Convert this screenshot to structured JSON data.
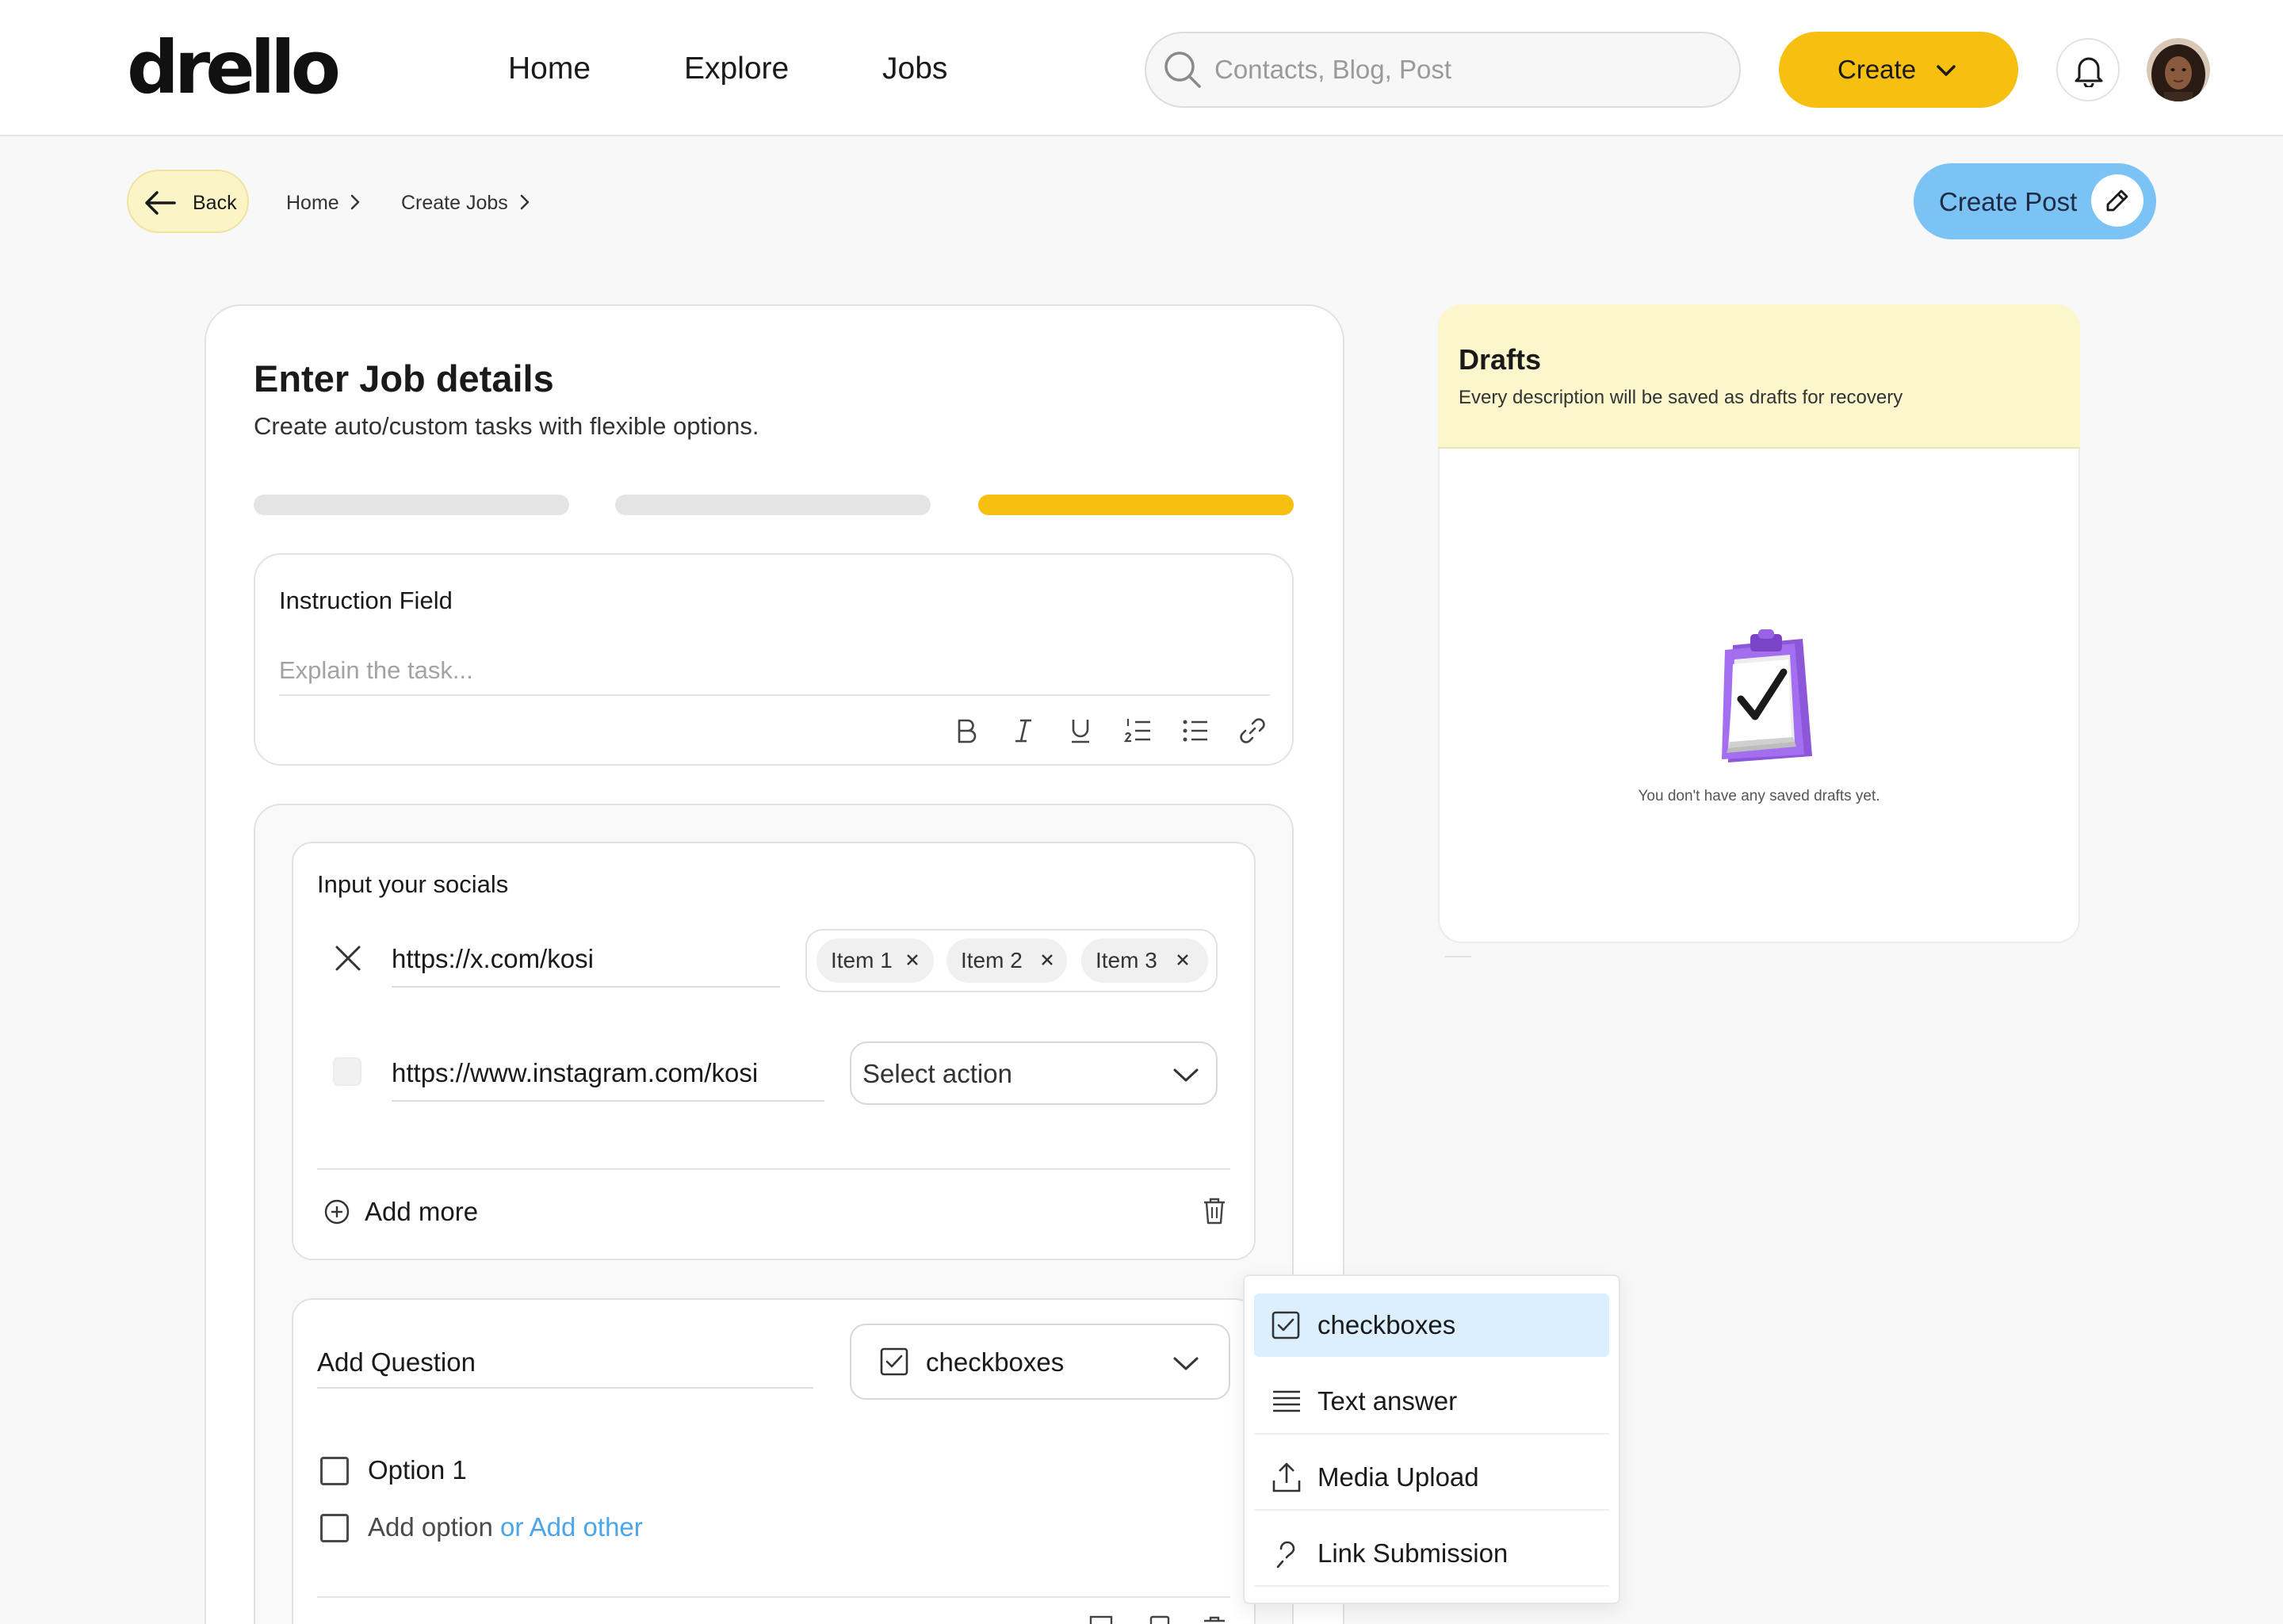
{
  "header": {
    "logo": "drello",
    "nav": [
      "Home",
      "Explore",
      "Jobs"
    ],
    "search": {
      "placeholder": "Contacts, Blog, Post",
      "icon": "search-icon"
    },
    "create_label": "Create",
    "notification_icon": "bell-icon",
    "avatar": "user-avatar"
  },
  "breadcrumb": {
    "back_label": "Back",
    "items": [
      "Home",
      "Create Jobs"
    ],
    "create_post_label": "Create Post"
  },
  "form": {
    "title": "Enter Job details",
    "subtitle": "Create auto/custom tasks with flexible options.",
    "steps": [
      {
        "state": "inactive"
      },
      {
        "state": "inactive"
      },
      {
        "state": "active"
      }
    ],
    "instruction": {
      "label": "Instruction Field",
      "placeholder": "Explain the task...",
      "toolbar": [
        "bold-icon",
        "italic-icon",
        "underline-icon",
        "ordered-list-icon",
        "bullet-list-icon",
        "link-icon"
      ]
    },
    "socials": {
      "label": "Input your socials",
      "rows": [
        {
          "url": "https://x.com/kosi",
          "tags": [
            "Item 1",
            "Item 2",
            "Item 3"
          ]
        },
        {
          "url": "https://www.instagram.com/kosi",
          "action_placeholder": "Select action"
        }
      ],
      "add_more_label": "Add more"
    },
    "question": {
      "label": "Add Question",
      "type_selected": "checkboxes",
      "options": [
        "Option 1"
      ],
      "add_option_label": "Add option",
      "add_other_label": "or Add other"
    }
  },
  "question_type_dropdown": {
    "items": [
      {
        "label": "checkboxes",
        "icon": "checkbox-icon",
        "selected": true
      },
      {
        "label": "Text answer",
        "icon": "text-lines-icon",
        "selected": false
      },
      {
        "label": "Media Upload",
        "icon": "upload-icon",
        "selected": false
      },
      {
        "label": "Link Submission",
        "icon": "link-submission-icon",
        "selected": false
      }
    ]
  },
  "drafts": {
    "title": "Drafts",
    "subtitle": "Every description will be saved as drafts for recovery",
    "empty_text": "You don't have any saved drafts yet.",
    "illustration": "clipboard-check-illustration"
  },
  "colors": {
    "accent_yellow": "#f7bf0f",
    "accent_blue": "#7cc3f5",
    "link_blue": "#4aa6e8",
    "selected_bg": "#dcefff"
  }
}
